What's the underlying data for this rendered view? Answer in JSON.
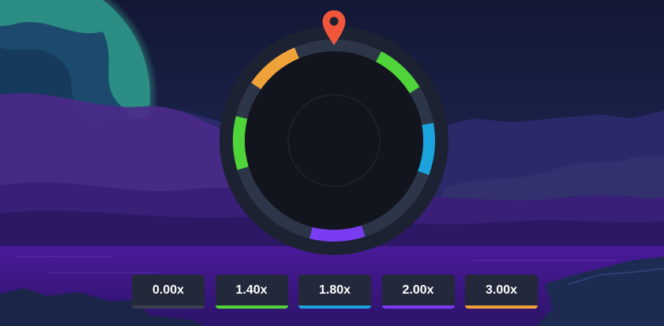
{
  "colors": {
    "sky_top": "#121834",
    "sky_bottom": "#2a1f5a",
    "planet_glow": "#3fb59a",
    "planet_body": "#1b4a6d",
    "water": "#3d1a8a",
    "wheel_outer": "#1c2231",
    "wheel_track": "#2c3648",
    "wheel_inner": "#12151e",
    "pin": "#f1563a",
    "gray": "#3a4050",
    "green": "#4fd43a",
    "blue": "#1aa3dc",
    "purple": "#7a3cf0",
    "orange": "#f0a23a"
  },
  "pointer_icon": "map-pin-icon",
  "wheel": {
    "segments": [
      {
        "color_key": "green",
        "label": "1.40x"
      },
      {
        "color_key": "blue",
        "label": "1.80x"
      },
      {
        "color_key": "purple",
        "label": "2.00x"
      },
      {
        "color_key": "green",
        "label": "1.40x"
      },
      {
        "color_key": "orange",
        "label": "3.00x"
      }
    ]
  },
  "multipliers": [
    {
      "label": "0.00x",
      "color_key": "gray"
    },
    {
      "label": "1.40x",
      "color_key": "green"
    },
    {
      "label": "1.80x",
      "color_key": "blue"
    },
    {
      "label": "2.00x",
      "color_key": "purple"
    },
    {
      "label": "3.00x",
      "color_key": "orange"
    }
  ]
}
